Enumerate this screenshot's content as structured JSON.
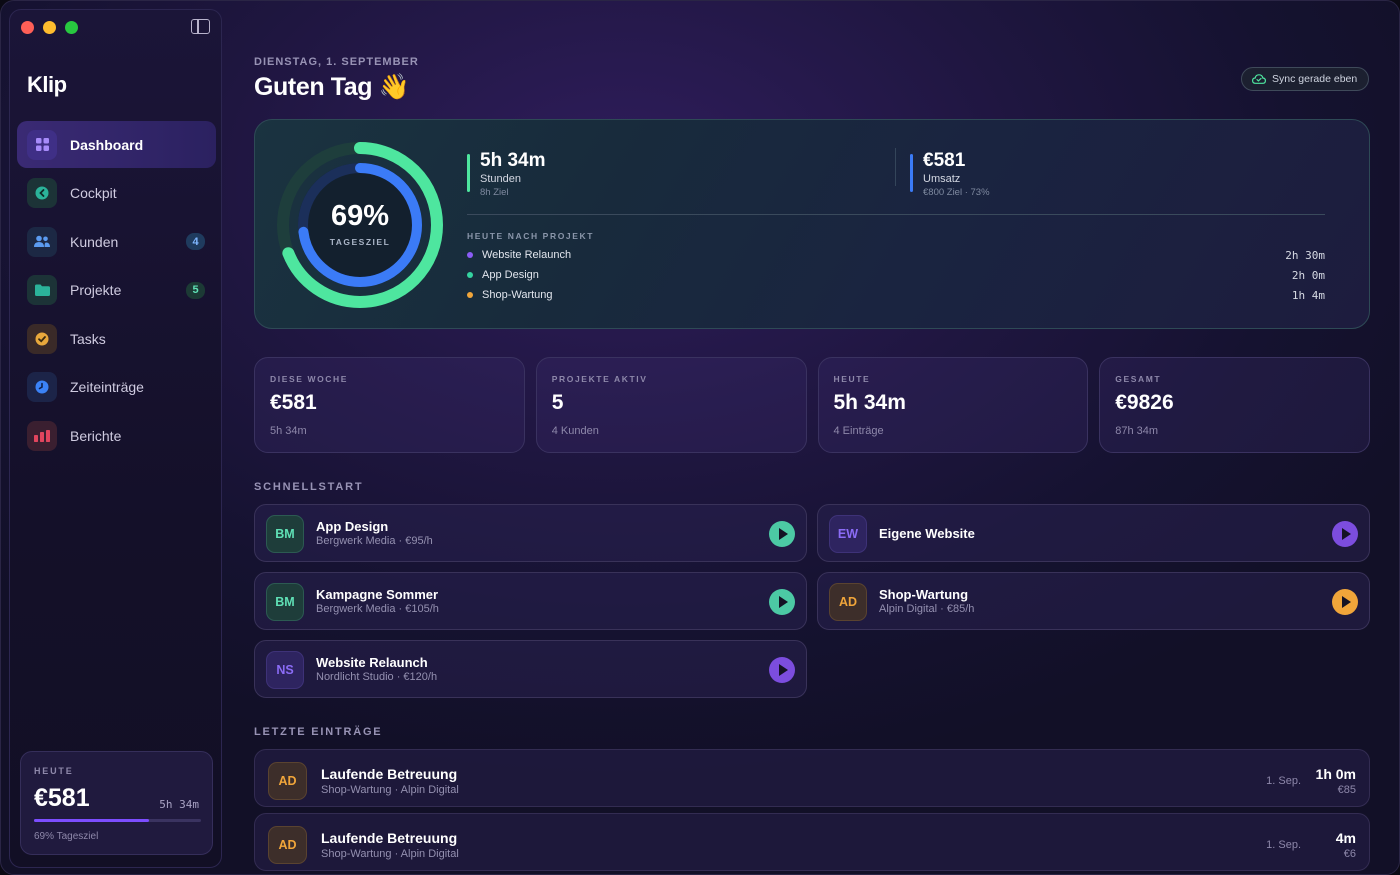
{
  "app": {
    "name": "Klip"
  },
  "sidebar": {
    "items": [
      {
        "label": "Dashboard",
        "icon": "grid-icon",
        "color": "#8b5cf6",
        "badge": null,
        "active": true
      },
      {
        "label": "Cockpit",
        "icon": "gauge-icon",
        "color": "#2bb39a",
        "badge": null
      },
      {
        "label": "Kunden",
        "icon": "users-icon",
        "color": "#4a90e2",
        "badge": "4"
      },
      {
        "label": "Projekte",
        "icon": "folder-icon",
        "color": "#2bb39a",
        "badge": "5"
      },
      {
        "label": "Tasks",
        "icon": "check-circle-icon",
        "color": "#e8a83c",
        "badge": null
      },
      {
        "label": "Zeiteinträge",
        "icon": "clock-icon",
        "color": "#3b82f6",
        "badge": null
      },
      {
        "label": "Berichte",
        "icon": "bar-chart-icon",
        "color": "#e0455e",
        "badge": null
      }
    ],
    "today_card": {
      "label": "HEUTE",
      "amount": "€581",
      "time": "5h 34m",
      "progress": 0.69,
      "footer": "69% Tagesziel"
    }
  },
  "header": {
    "date": "DIENSTAG, 1. SEPTEMBER",
    "greeting": "Guten Tag 👋",
    "sync_label": "Sync gerade eben"
  },
  "hero": {
    "ring_percent": "69%",
    "ring_label": "TAGESZIEL",
    "ring_outer_fraction": 0.69,
    "ring_inner_fraction": 0.73,
    "ring_outer_color": "#4ee69f",
    "ring_inner_color": "#3b7bf7",
    "hours": {
      "value": "5h 34m",
      "label": "Stunden",
      "sub": "8h Ziel"
    },
    "revenue": {
      "value": "€581",
      "label": "Umsatz",
      "sub": "€800 Ziel · 73%"
    },
    "projects_heading": "HEUTE NACH PROJEKT",
    "projects": [
      {
        "name": "Website Relaunch",
        "time": "2h 30m",
        "color": "#8b5cf6"
      },
      {
        "name": "App Design",
        "time": "2h 0m",
        "color": "#34d3a0"
      },
      {
        "name": "Shop-Wartung",
        "time": "1h 4m",
        "color": "#f0a53a"
      }
    ]
  },
  "kpis": [
    {
      "label": "DIESE WOCHE",
      "value": "€581",
      "sub": "5h 34m"
    },
    {
      "label": "PROJEKTE AKTIV",
      "value": "5",
      "sub": "4 Kunden"
    },
    {
      "label": "HEUTE",
      "value": "5h 34m",
      "sub": "4 Einträge"
    },
    {
      "label": "GESAMT",
      "value": "€9826",
      "sub": "87h 34m"
    }
  ],
  "quickstart": {
    "title": "SCHNELLSTART",
    "items": [
      {
        "initials": "BM",
        "title": "App Design",
        "sub": "Bergwerk Media · €95/h",
        "color": "#34d3a0"
      },
      {
        "initials": "EW",
        "title": "Eigene Website",
        "sub": "",
        "color": "#8b5cf6"
      },
      {
        "initials": "BM",
        "title": "Kampagne Sommer",
        "sub": "Bergwerk Media · €105/h",
        "color": "#34d3a0"
      },
      {
        "initials": "AD",
        "title": "Shop-Wartung",
        "sub": "Alpin Digital · €85/h",
        "color": "#f0a53a"
      },
      {
        "initials": "NS",
        "title": "Website Relaunch",
        "sub": "Nordlicht Studio · €120/h",
        "color": "#8b5cf6"
      }
    ]
  },
  "recent": {
    "title": "LETZTE EINTRÄGE",
    "items": [
      {
        "initials": "AD",
        "title": "Laufende Betreuung",
        "sub": "Shop-Wartung · Alpin Digital",
        "date": "1. Sep.",
        "duration": "1h 0m",
        "amount": "€85",
        "color": "#f0a53a"
      },
      {
        "initials": "AD",
        "title": "Laufende Betreuung",
        "sub": "Shop-Wartung · Alpin Digital",
        "date": "1. Sep.",
        "duration": "4m",
        "amount": "€6",
        "color": "#f0a53a"
      }
    ]
  }
}
